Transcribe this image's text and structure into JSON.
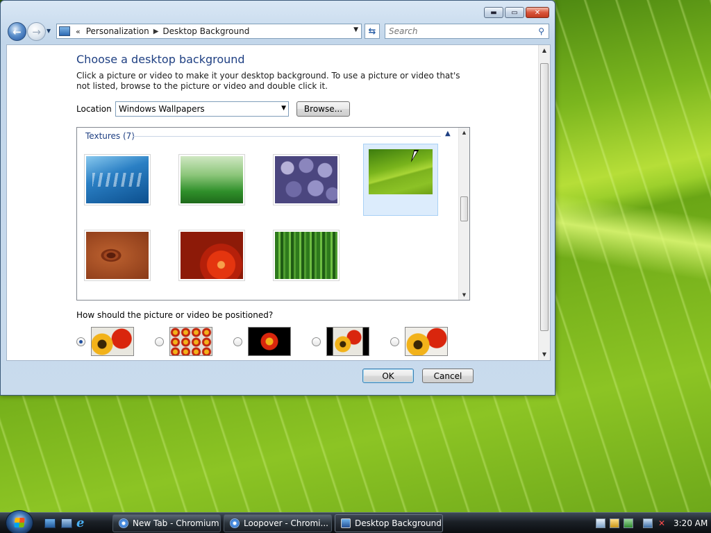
{
  "window": {
    "caption_buttons": [
      "minimize",
      "maximize",
      "close"
    ]
  },
  "nav": {
    "back_label": "←",
    "forward_label": "→",
    "history_label": "▼",
    "address_chevron": "«",
    "breadcrumbs": [
      "Personalization",
      "Desktop Background"
    ],
    "search_placeholder": "Search"
  },
  "page": {
    "title": "Choose a desktop background",
    "description": "Click a picture or video to make it your desktop background. To use a picture or video that's not listed, browse to the picture or video and double click it.",
    "location_label": "Location",
    "location_value": "Windows Wallpapers",
    "browse_label": "Browse...",
    "group_header": "Textures (7)",
    "wallpapers": [
      {
        "name": "fish",
        "selected": false
      },
      {
        "name": "grass",
        "selected": false
      },
      {
        "name": "pebbles",
        "selected": false
      },
      {
        "name": "green-leaf",
        "selected": true
      },
      {
        "name": "wood",
        "selected": false
      },
      {
        "name": "red-flower",
        "selected": false
      },
      {
        "name": "bamboo",
        "selected": false
      }
    ],
    "position_label": "How should the picture or video be positioned?",
    "position_options": [
      "fill",
      "tile",
      "center",
      "fit",
      "stretch"
    ],
    "position_selected": "fill",
    "ok_label": "OK",
    "cancel_label": "Cancel"
  },
  "taskbar": {
    "items": [
      {
        "label": "New Tab - Chromium",
        "active": false,
        "icon": "chromium-icon"
      },
      {
        "label": "Loopover - Chromi...",
        "active": false,
        "icon": "chromium-icon"
      },
      {
        "label": "Desktop Background",
        "active": true,
        "icon": "display-icon"
      }
    ],
    "clock": "3:20 AM"
  },
  "colors": {
    "title_blue": "#1e3f82",
    "selection_bg": "#dcecfc",
    "taskbar_dark": "#1b2026"
  }
}
